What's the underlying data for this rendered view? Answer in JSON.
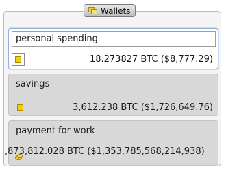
{
  "panel": {
    "title": "Wallets",
    "title_icon": "wallets-icon"
  },
  "wallets": [
    {
      "name": "personal spending",
      "balance": "18.273827 BTC ($8,777.29)",
      "icon": "wallet-icon",
      "selected": true
    },
    {
      "name": "savings",
      "balance": "3,612.238 BTC ($1,726,649.76)",
      "icon": "wallet-icon",
      "selected": false
    },
    {
      "name": "payment for work",
      "balance": ",873,812.028 BTC ($1,353,785,568,214,938)",
      "icon": "coins-icon",
      "selected": false
    }
  ],
  "colors": {
    "selected_border": "#8eb0dd",
    "card_background": "#d8d8d8",
    "icon_yellow": "#f2d000"
  }
}
